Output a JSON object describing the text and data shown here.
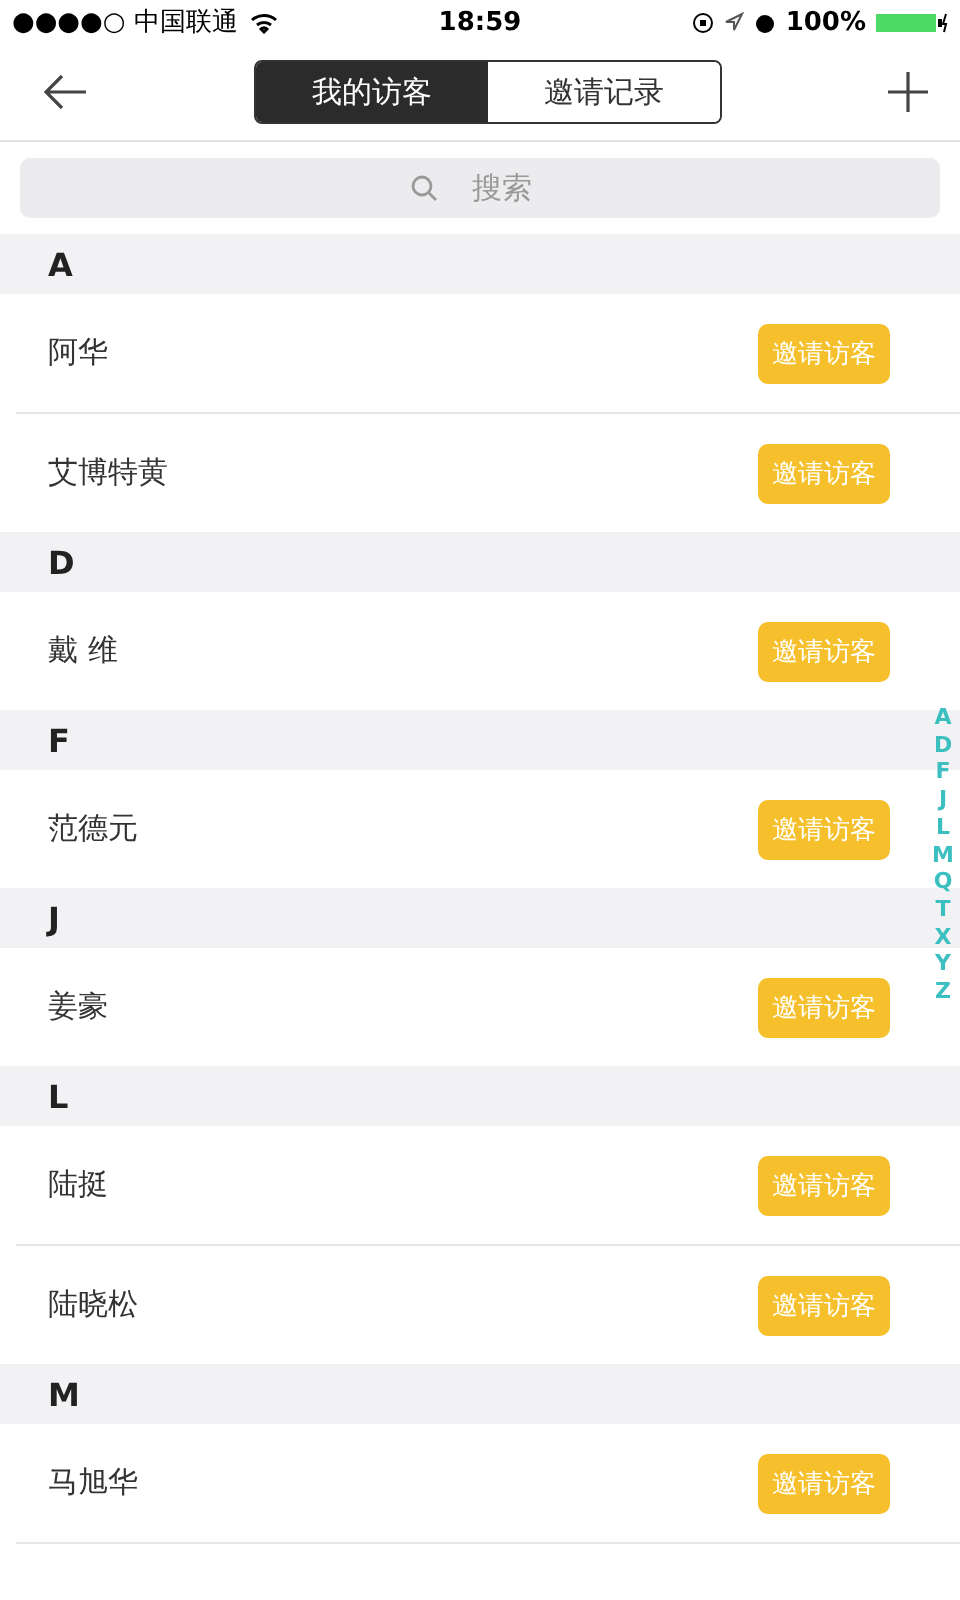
{
  "status_bar": {
    "carrier": "●●●●○ 中国联通",
    "time": "18:59",
    "battery": "100%"
  },
  "segments": [
    {
      "label": "我的访客",
      "selected": true
    },
    {
      "label": "邀请记录",
      "selected": false
    }
  ],
  "search": {
    "placeholder": "搜索"
  },
  "sections": [
    {
      "letter": "A",
      "contacts": [
        {
          "name": "阿华",
          "action": "邀请访客"
        },
        {
          "name": "艾博特黄",
          "action": "邀请访客"
        }
      ]
    },
    {
      "letter": "D",
      "contacts": [
        {
          "name": "戴 维",
          "action": "邀请访客"
        }
      ]
    },
    {
      "letter": "F",
      "contacts": [
        {
          "name": "范德元",
          "action": "邀请访客"
        }
      ]
    },
    {
      "letter": "J",
      "contacts": [
        {
          "name": "姜豪",
          "action": "邀请访客"
        }
      ]
    },
    {
      "letter": "L",
      "contacts": [
        {
          "name": "陆挺",
          "action": "邀请访客"
        },
        {
          "name": "陆晓松",
          "action": "邀请访客"
        }
      ]
    },
    {
      "letter": "M",
      "contacts": [
        {
          "name": "马旭华",
          "action": "邀请访客"
        }
      ]
    }
  ],
  "index": [
    "A",
    "D",
    "F",
    "J",
    "L",
    "M",
    "Q",
    "T",
    "X",
    "Y",
    "Z"
  ]
}
